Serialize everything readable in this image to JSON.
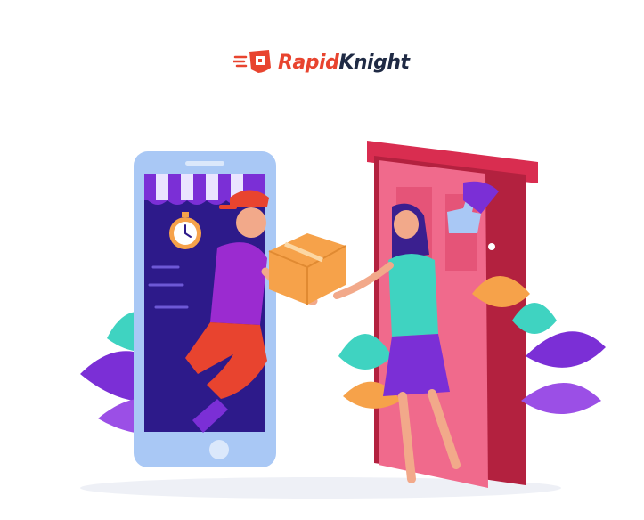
{
  "brand": {
    "name_part1": "Rapid",
    "name_part2": "Knight",
    "logo_icon": "fast-delivery-box-icon"
  },
  "colors": {
    "brand_red": "#e8442f",
    "brand_dark": "#1f2a44",
    "phone_frame": "#a9c8f5",
    "phone_screen": "#2d1a8a",
    "door_red": "#d92d50",
    "leaf_purple": "#7b2fd6",
    "leaf_orange": "#f6a24a",
    "leaf_teal": "#3fd3c1"
  }
}
